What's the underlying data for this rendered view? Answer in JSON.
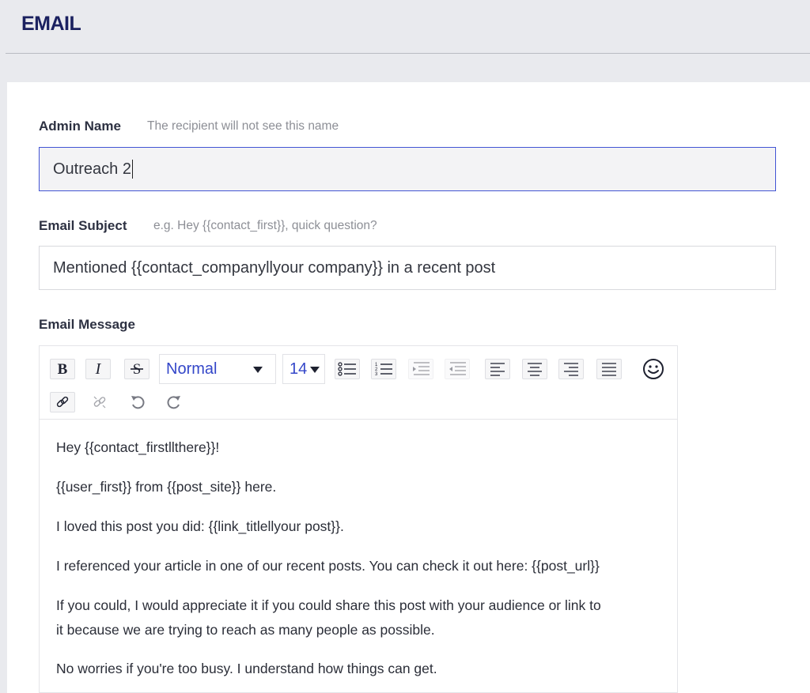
{
  "header": {
    "title": "EMAIL"
  },
  "admin_name": {
    "label": "Admin Name",
    "hint": "The recipient will not see this name",
    "value": "Outreach 2"
  },
  "email_subject": {
    "label": "Email Subject",
    "hint": "e.g. Hey {{contact_first}}, quick question?",
    "value": "Mentioned {{contact_companyllyour company}} in a recent post"
  },
  "email_message": {
    "label": "Email Message",
    "toolbar": {
      "style_value": "Normal",
      "size_value": "14"
    },
    "paragraphs": [
      "Hey {{contact_firstllthere}}!",
      "{{user_first}} from {{post_site}} here.",
      "I loved this post you did: {{link_titlellyour post}}.",
      "I referenced your article in one of our recent posts. You can check it out here: {{post_url}}",
      "If you could, I would appreciate it if you could share this post with your audience or link to",
      "it because we are trying to reach as many people as possible.",
      "No worries if you're too busy. I understand how things can get."
    ]
  },
  "colors": {
    "accent": "#4254d4",
    "title": "#1b2160"
  }
}
